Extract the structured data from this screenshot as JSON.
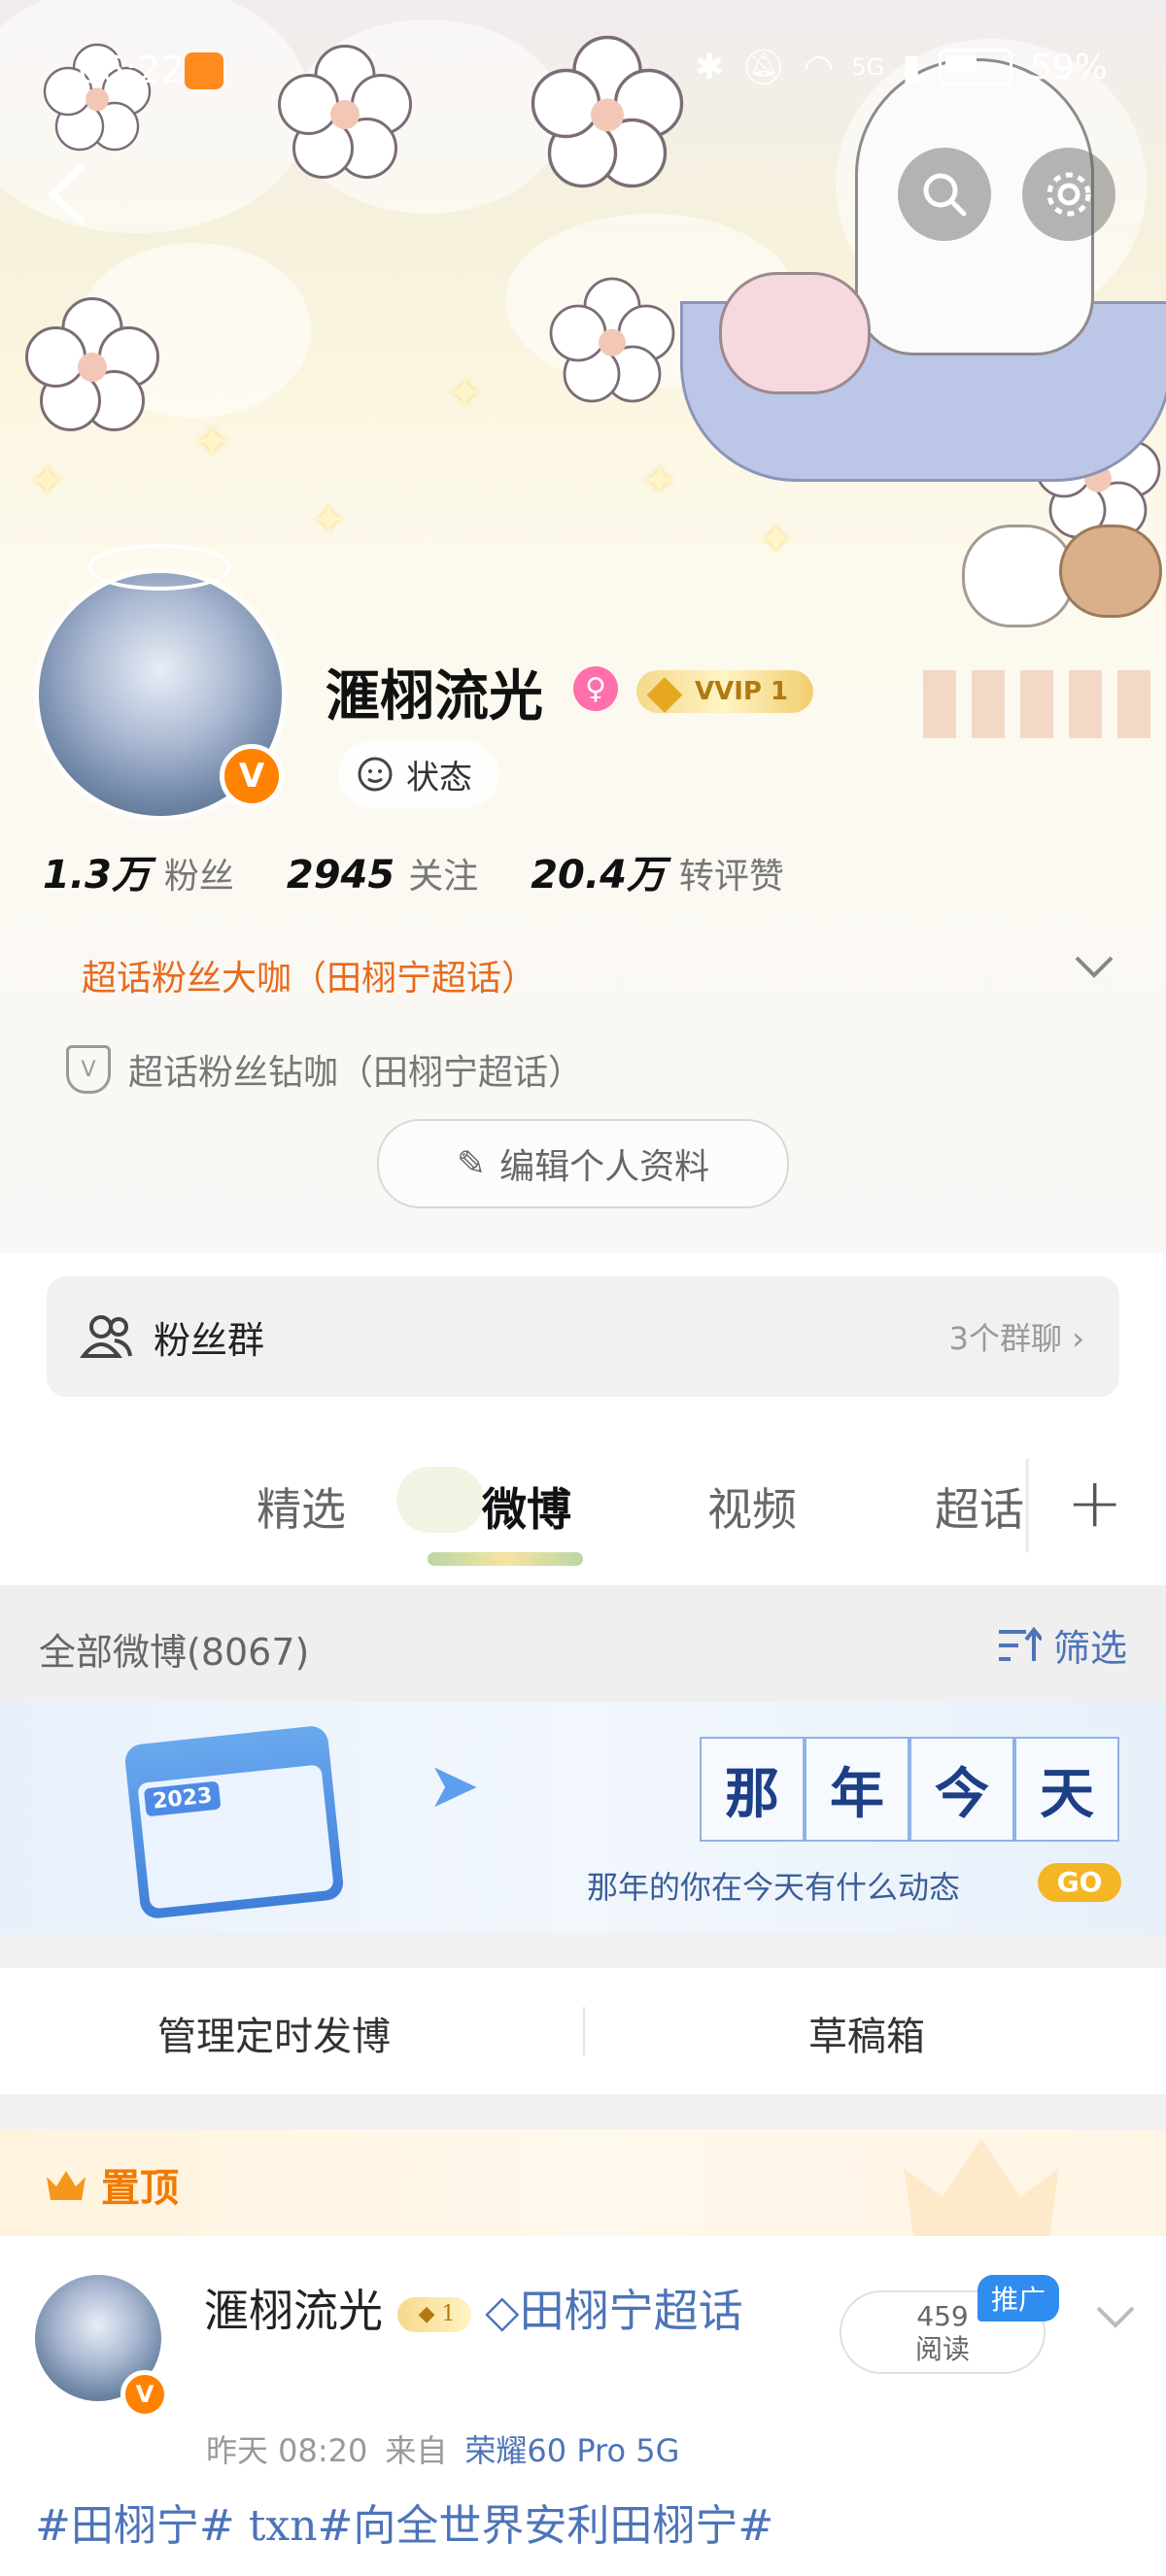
{
  "status_bar": {
    "time": "06:22",
    "battery": "59%",
    "network": "5G"
  },
  "profile": {
    "name": "滙栩流光",
    "vvip_label": "VVIP 1",
    "status_label": "状态",
    "stats": [
      {
        "value": "1.3万",
        "label": "粉丝"
      },
      {
        "value": "2945",
        "label": "关注"
      },
      {
        "value": "20.4万",
        "label": "转评赞"
      }
    ],
    "superfan_primary": "超话粉丝大咖（田栩宁超话）",
    "superfan_secondary": "超话粉丝钻咖（田栩宁超话）",
    "edit_button": "编辑个人资料"
  },
  "fan_group": {
    "label": "粉丝群",
    "count": "3个群聊"
  },
  "tabs": [
    {
      "label": "精选"
    },
    {
      "label": "微博"
    },
    {
      "label": "视频"
    },
    {
      "label": "超话"
    }
  ],
  "filter_bar": {
    "all_label": "全部微博(8067)",
    "filter_label": "筛选"
  },
  "banner": {
    "calendar_year": "2023",
    "title_chars": [
      "那",
      "年",
      "今",
      "天"
    ],
    "subtitle": "那年的你在今天有什么动态",
    "go_label": "GO"
  },
  "actions": {
    "scheduled": "管理定时发博",
    "drafts": "草稿箱"
  },
  "pinned": {
    "label": "置顶",
    "author": "滙栩流光",
    "author_badge": "1",
    "topic_badge": "田栩宁超话",
    "time": "昨天 08:20",
    "source_prefix": "来自",
    "source": "荣耀60 Pro 5G",
    "read_count": "459",
    "read_label": "阅读",
    "promo": "推广",
    "text": "#田栩宁# txn#向全世界安利田栩宁#"
  },
  "colors": {
    "accent_orange": "#ff8200",
    "link_blue": "#4d74b8",
    "vip_gold": "#e5a820"
  }
}
